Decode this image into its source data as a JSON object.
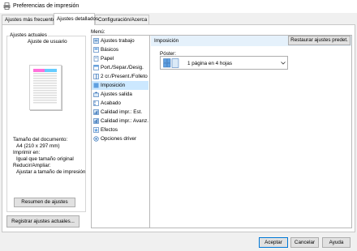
{
  "window": {
    "title": "Preferencias de impresión"
  },
  "tabs": [
    {
      "label": "Ajustes más frecuentes",
      "active": false
    },
    {
      "label": "Ajustes detallados",
      "active": true
    },
    {
      "label": "Configuración/Acerca de",
      "active": false
    }
  ],
  "left": {
    "group_title": "Ajustes actuales",
    "preview_caption": "Ajuste de usuario",
    "info_lines": [
      "Tamaño del documento:",
      "  A4 (210 x 297 mm)",
      "Imprimir en:",
      "  Igual que tamaño original",
      "Reducir/Ampliar:",
      "  Ajustar a tamaño de impresión"
    ],
    "summary_button": "Resumen de ajustes",
    "register_button": "Registrar ajustes actuales..."
  },
  "menu": {
    "label": "Menú:",
    "items": [
      {
        "label": "Ajustes trabajo",
        "icon": "job-settings-icon"
      },
      {
        "label": "Básicos",
        "icon": "basic-icon"
      },
      {
        "label": "Papel",
        "icon": "paper-icon"
      },
      {
        "label": "Port./Separ./Desig.",
        "icon": "cover-icon"
      },
      {
        "label": "2 cr./Present./Folleto",
        "icon": "duplex-icon"
      },
      {
        "label": "Imposición",
        "icon": "imposition-icon",
        "selected": true
      },
      {
        "label": "Ajustes salida",
        "icon": "output-icon"
      },
      {
        "label": "Acabado",
        "icon": "finishing-icon"
      },
      {
        "label": "Calidad impr.: Est.",
        "icon": "quality-standard-icon"
      },
      {
        "label": "Calidad impr.: Avanz.",
        "icon": "quality-advanced-icon"
      },
      {
        "label": "Efectos",
        "icon": "effects-icon"
      },
      {
        "label": "Opciones driver",
        "icon": "driver-options-icon"
      }
    ]
  },
  "content": {
    "header": "Imposición",
    "restore_button": "Restaurar ajustes predet.",
    "poster_label": "Póster:",
    "poster_value": "1 página en 4 hojas"
  },
  "footer": {
    "accept": "Aceptar",
    "cancel": "Cancelar",
    "help": "Ayuda"
  },
  "colors": {
    "accent": "#0078d7",
    "selection": "#cce8ff",
    "header_bg": "#e5f1fb"
  }
}
